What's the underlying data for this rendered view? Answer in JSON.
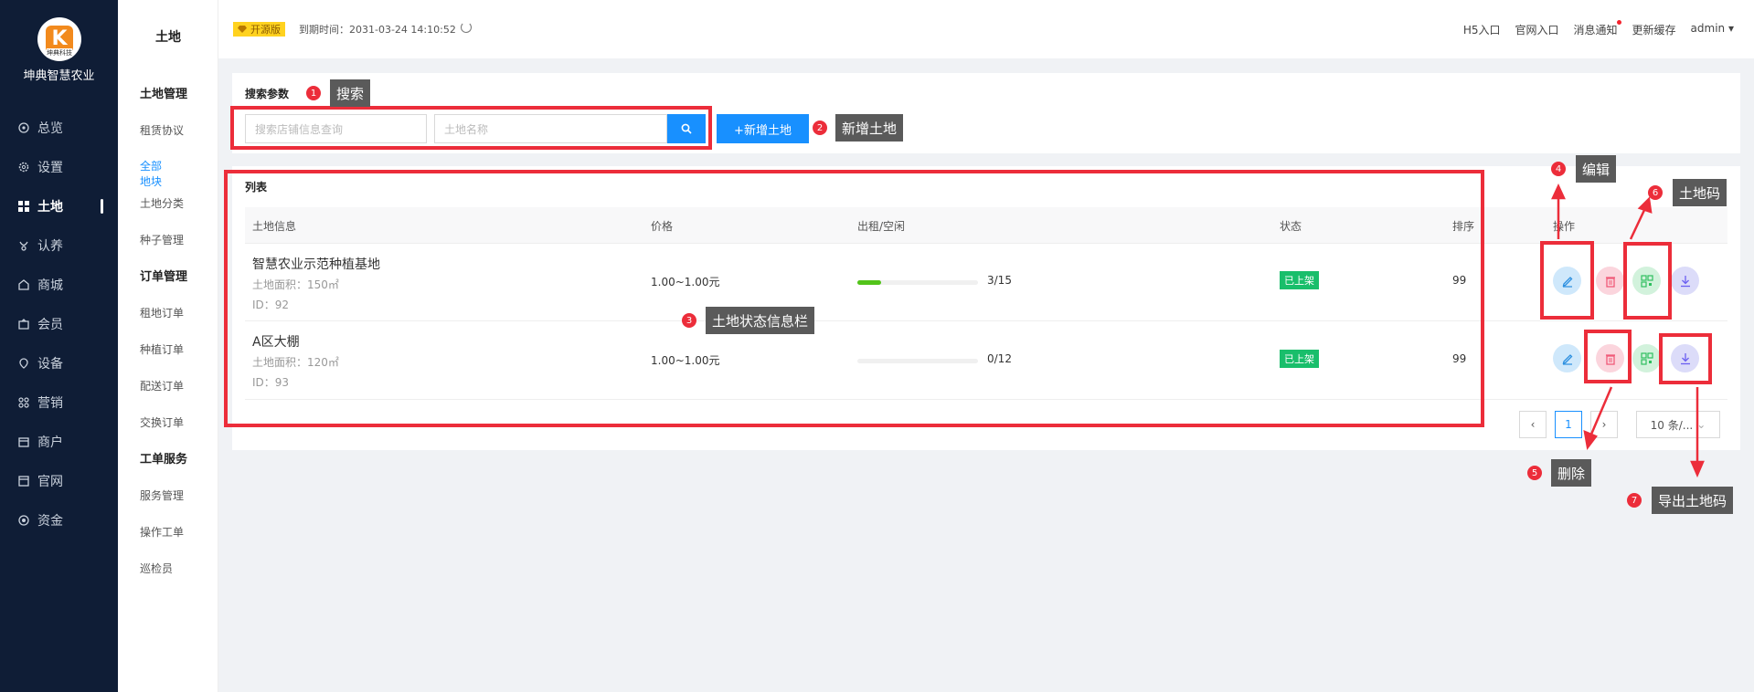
{
  "brand": {
    "logo_letter": "K",
    "logo_sub": "坤典科技",
    "name": "坤典智慧农业"
  },
  "nav": [
    {
      "label": "总览",
      "icon": "dashboard-icon"
    },
    {
      "label": "设置",
      "icon": "gear-icon"
    },
    {
      "label": "土地",
      "icon": "grid-icon",
      "active": true
    },
    {
      "label": "认养",
      "icon": "adopt-icon"
    },
    {
      "label": "商城",
      "icon": "shop-icon"
    },
    {
      "label": "会员",
      "icon": "member-icon"
    },
    {
      "label": "设备",
      "icon": "device-icon"
    },
    {
      "label": "营销",
      "icon": "marketing-icon"
    },
    {
      "label": "商户",
      "icon": "merchant-icon"
    },
    {
      "label": "官网",
      "icon": "website-icon"
    },
    {
      "label": "资金",
      "icon": "funds-icon"
    }
  ],
  "subnav": {
    "title": "土地",
    "groups": [
      {
        "title": "土地管理",
        "items": [
          "租赁协议",
          "全部地块",
          "土地分类",
          "种子管理"
        ]
      },
      {
        "title": "订单管理",
        "items": [
          "租地订单",
          "种植订单",
          "配送订单",
          "交换订单"
        ]
      },
      {
        "title": "工单服务",
        "items": [
          "服务管理",
          "操作工单",
          "巡检员"
        ]
      }
    ],
    "active_item": "全部地块"
  },
  "topbar": {
    "badge": "开源版",
    "expire": "到期时间：2031-03-24 14:10:52",
    "links": [
      "H5入口",
      "官网入口",
      "消息通知",
      "更新缓存",
      "admin"
    ]
  },
  "search": {
    "title": "搜索参数",
    "placeholder_shop": "搜索店铺信息查询",
    "placeholder_name": "土地名称",
    "add_label": "+新增土地"
  },
  "list": {
    "title": "列表",
    "columns": [
      "土地信息",
      "价格",
      "出租/空闲",
      "状态",
      "排序",
      "操作"
    ],
    "rows": [
      {
        "name": "智慧农业示范种植基地",
        "area": "土地面积：150㎡",
        "id": "ID：92",
        "price": "1.00~1.00元",
        "rented": 3,
        "total": 15,
        "rent_text": "3/15",
        "status": "已上架",
        "sort": "99"
      },
      {
        "name": "A区大棚",
        "area": "土地面积：120㎡",
        "id": "ID：93",
        "price": "1.00~1.00元",
        "rented": 0,
        "total": 12,
        "rent_text": "0/12",
        "status": "已上架",
        "sort": "99"
      }
    ]
  },
  "pagination": {
    "current": "1",
    "page_size": "10 条/..."
  },
  "annotations": [
    {
      "num": "1",
      "text": "搜索"
    },
    {
      "num": "2",
      "text": "新增土地"
    },
    {
      "num": "3",
      "text": "土地状态信息栏"
    },
    {
      "num": "4",
      "text": "编辑"
    },
    {
      "num": "5",
      "text": "删除"
    },
    {
      "num": "6",
      "text": "土地码"
    },
    {
      "num": "7",
      "text": "导出土地码"
    }
  ],
  "colors": {
    "sidebar": "#0f1d36",
    "primary": "#1890ff",
    "annotation": "#ec2d3a",
    "status": "#19be6b"
  }
}
